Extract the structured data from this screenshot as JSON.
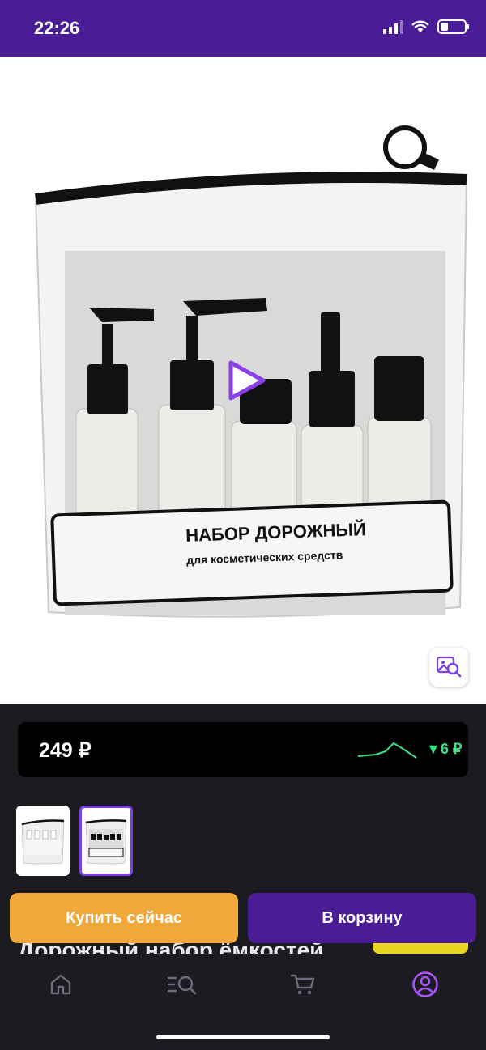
{
  "status_bar": {
    "time": "22:26"
  },
  "header": {
    "back_icon": "chevron-left-icon",
    "favorite_icon": "heart-icon",
    "share_icon": "share-icon"
  },
  "product_image": {
    "label_title": "НАБОР ДОРОЖНЫЙ",
    "label_subtitle": "для косметических средств"
  },
  "price": {
    "value": "249 ₽",
    "change": "▼6 ₽",
    "change_color": "#3ddc84"
  },
  "thumbnails": {
    "count": 2,
    "active_index": 1
  },
  "product_title_peek": "Дорожный набор ёмкостей",
  "buttons": {
    "buy_now": "Купить сейчас",
    "add_to_cart": "В корзину"
  },
  "tabbar": {
    "items": [
      "home-icon",
      "catalog-search-icon",
      "cart-icon",
      "profile-icon"
    ],
    "active": "profile-icon"
  },
  "colors": {
    "brand": "#4a1d96",
    "accent": "#7b3fe4",
    "buy_now": "#f0a83a",
    "background": "#1c1b22"
  }
}
